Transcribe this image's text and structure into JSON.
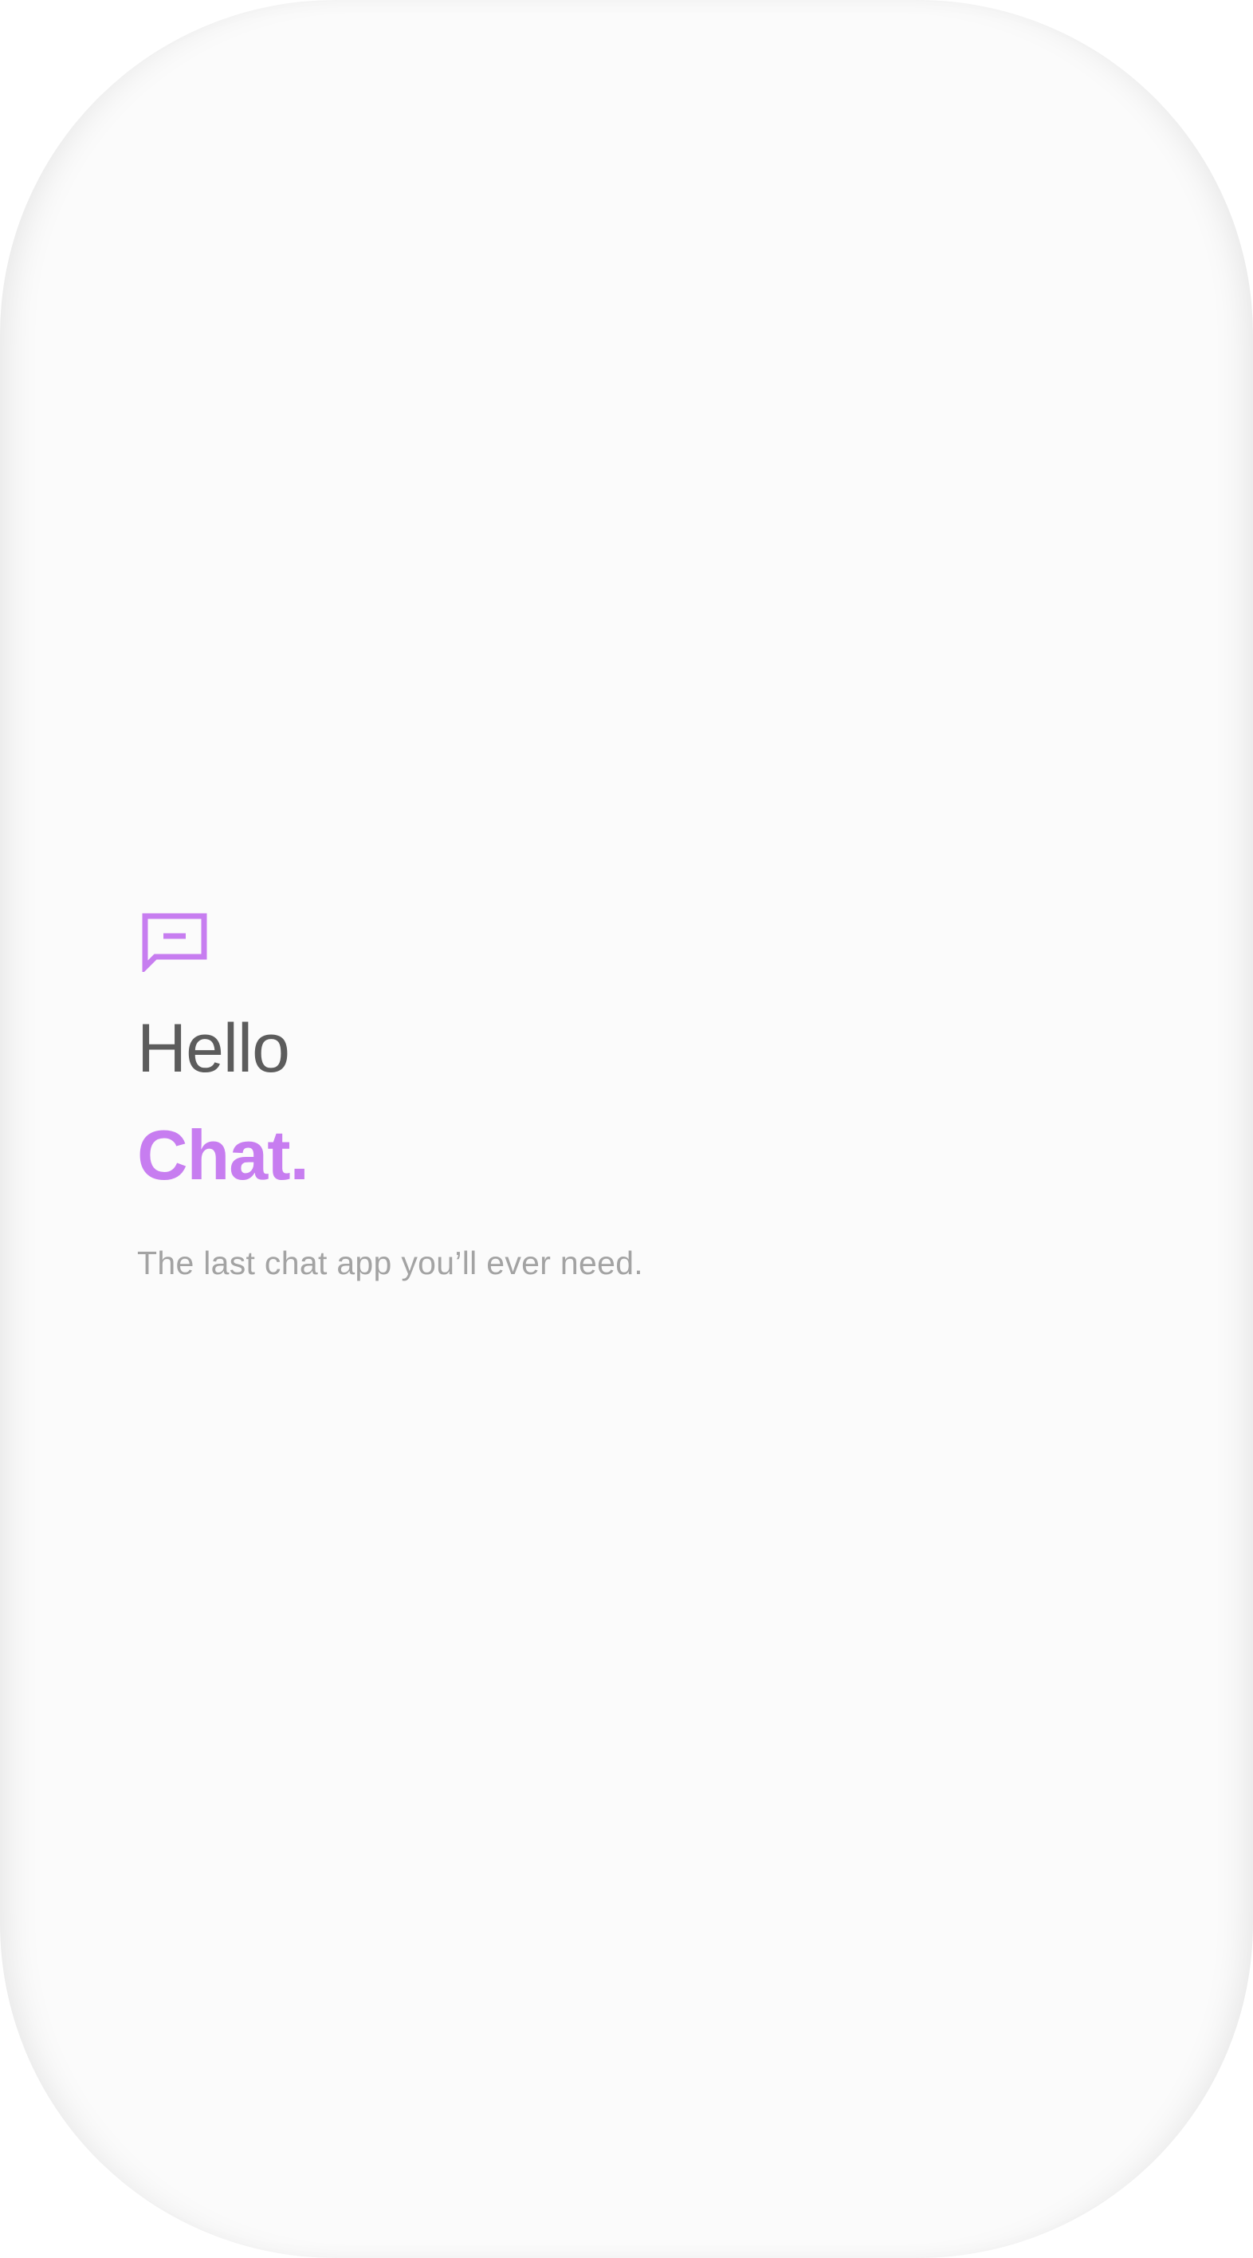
{
  "splash": {
    "icon": "chat-bubble-icon",
    "greeting": "Hello",
    "app_name": "Chat.",
    "tagline": "The last chat app you’ll ever need."
  },
  "colors": {
    "accent": "#c77df0",
    "greeting": "#5c5c5c",
    "tagline": "#a3a3a3",
    "background": "#fbfbfb"
  }
}
